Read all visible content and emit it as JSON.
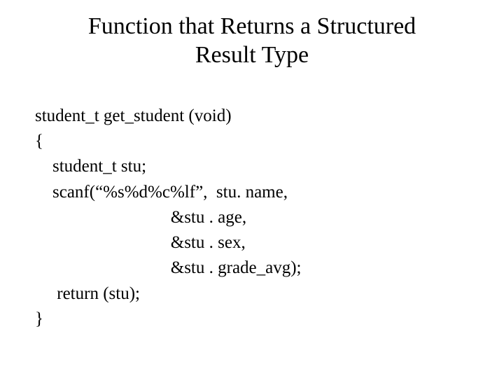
{
  "title_line1": "Function that Returns a Structured",
  "title_line2": "Result Type",
  "code": {
    "l1": "student_t get_student (void)",
    "l2": "{",
    "l3": "    student_t stu;",
    "l4": "    scanf(“%s%d%c%lf”,  stu. name,",
    "l5": "                               &stu . age,",
    "l6": "                               &stu . sex,",
    "l7": "                               &stu . grade_avg);",
    "l8": "     return (stu);",
    "l9": "}"
  }
}
